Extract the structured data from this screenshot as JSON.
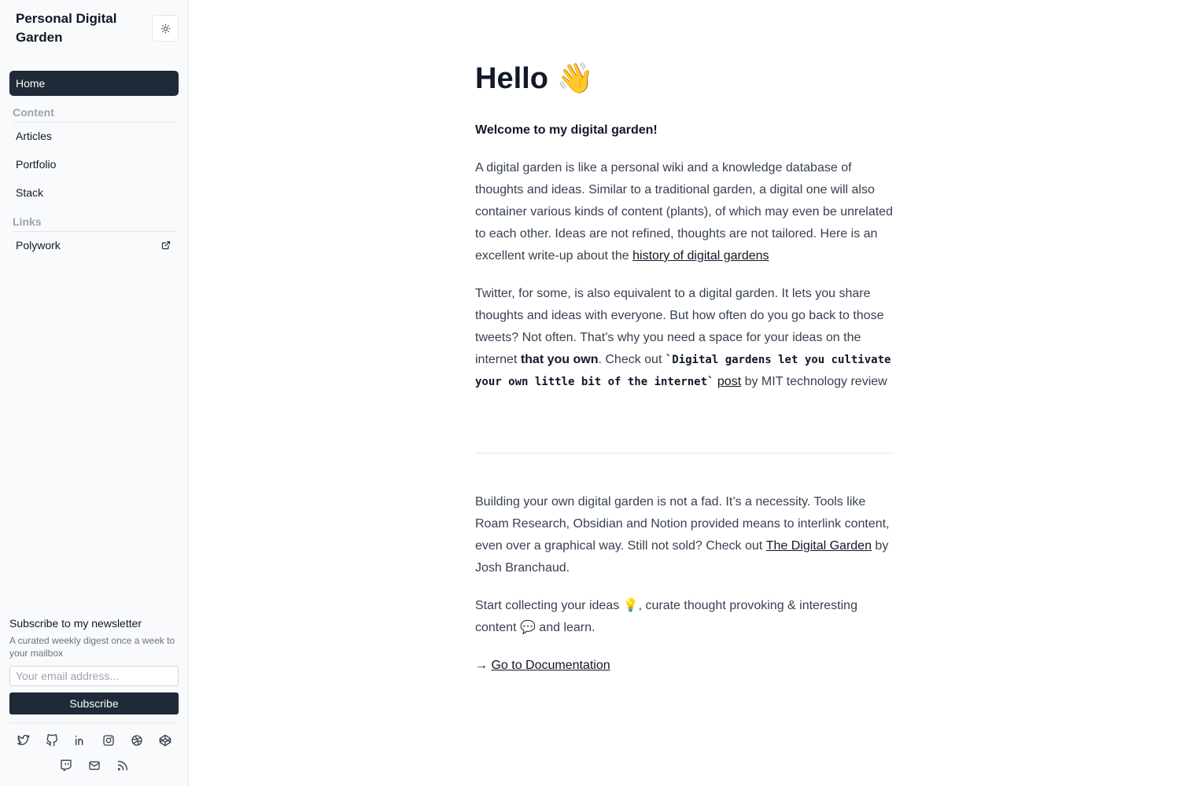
{
  "sidebar": {
    "title": "Personal Digital Garden",
    "home_label": "Home",
    "sections": {
      "content": {
        "label": "Content",
        "items": [
          "Articles",
          "Portfolio",
          "Stack"
        ]
      },
      "links": {
        "label": "Links",
        "items": [
          "Polywork"
        ]
      }
    },
    "newsletter": {
      "title": "Subscribe to my newsletter",
      "description": "A curated weekly digest once a week to your mailbox",
      "email_placeholder": "Your email address...",
      "subscribe_label": "Subscribe"
    },
    "social_icons": [
      "twitter-icon",
      "github-icon",
      "linkedin-icon",
      "instagram-icon",
      "dribbble-icon",
      "codepen-icon",
      "twitch-icon",
      "mail-icon",
      "rss-icon"
    ]
  },
  "main": {
    "heading": "Hello",
    "heading_emoji": "👋",
    "welcome": "Welcome to my digital garden!",
    "p1_text": "A digital garden is like a personal wiki and a knowledge database of thoughts and ideas. Similar to a traditional garden, a digital one will also container various kinds of content (plants), of which may even be unrelated to each other. Ideas are not refined, thoughts are not tailored. Here is an excellent write-up about the ",
    "p1_link": "history of digital gardens",
    "p2_text_a": "Twitter, for some, is also equivalent to a digital garden. It lets you share thoughts and ideas with everyone. But how often do you go back to those tweets? Not often. That’s why you need a space for your ideas on the internet ",
    "p2_bold": "that you own",
    "p2_text_b": ". Check out ",
    "p2_code": "`Digital gardens let you cultivate your own little bit of the internet`",
    "p2_link": "post",
    "p2_text_c": " by MIT technology review",
    "p3_text_a": "Building your own digital garden is not a fad. It’s a necessity. Tools like Roam Research, Obsidian and Notion provided means to interlink content, even over a graphical way. Still not sold? Check out ",
    "p3_link": "The Digital Garden",
    "p3_text_b": " by Josh Branchaud.",
    "p4_text_a": "Start collecting your ideas ",
    "p4_emoji_a": "💡",
    "p4_text_b": ", curate thought provoking & interesting content ",
    "p4_emoji_b": "💬",
    "p4_text_c": "  and learn.",
    "doc_arrow": "→ ",
    "doc_link": "Go to Documentation"
  },
  "colors": {
    "sidebar_bg": "#f9fafb",
    "accent_dark": "#1f2937",
    "muted": "#9ca3af"
  }
}
